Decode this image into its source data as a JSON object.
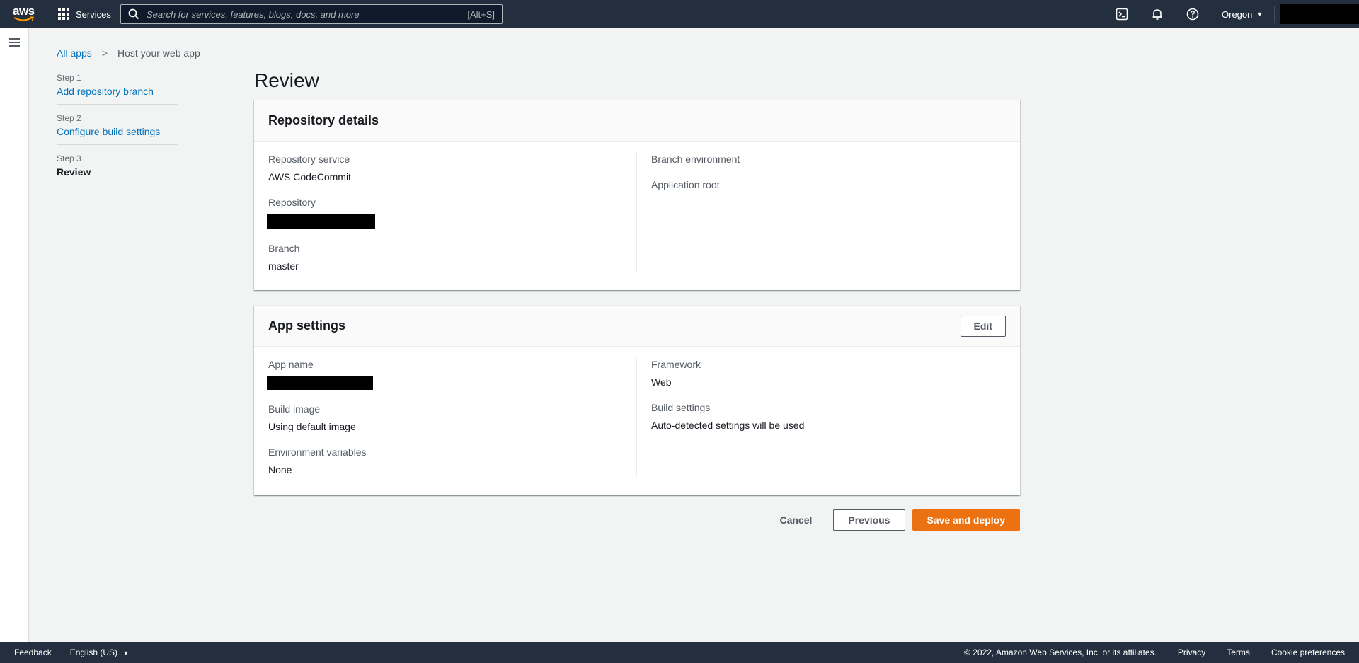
{
  "nav": {
    "logo_text": "aws",
    "services_label": "Services",
    "search_placeholder": "Search for services, features, blogs, docs, and more",
    "search_shortcut": "[Alt+S]",
    "region_label": "Oregon",
    "icons": [
      "cloudshell-icon",
      "bell-icon",
      "help-icon"
    ]
  },
  "breadcrumb": {
    "root": "All apps",
    "current": "Host your web app"
  },
  "steps": [
    {
      "num": "Step 1",
      "label": "Add repository branch",
      "state": "link"
    },
    {
      "num": "Step 2",
      "label": "Configure build settings",
      "state": "link"
    },
    {
      "num": "Step 3",
      "label": "Review",
      "state": "active"
    }
  ],
  "page_title": "Review",
  "repository_details": {
    "title": "Repository details",
    "service_label": "Repository service",
    "service_value": "AWS CodeCommit",
    "repository_label": "Repository",
    "branch_label": "Branch",
    "branch_value": "master",
    "branch_env_label": "Branch environment",
    "app_root_label": "Application root"
  },
  "app_settings": {
    "title": "App settings",
    "edit_label": "Edit",
    "app_name_label": "App name",
    "build_image_label": "Build image",
    "build_image_value": "Using default image",
    "env_vars_label": "Environment variables",
    "env_vars_value": "None",
    "framework_label": "Framework",
    "framework_value": "Web",
    "build_settings_label": "Build settings",
    "build_settings_value": "Auto-detected settings will be used"
  },
  "actions": {
    "cancel": "Cancel",
    "previous": "Previous",
    "save": "Save and deploy"
  },
  "footer": {
    "feedback": "Feedback",
    "language": "English (US)",
    "copyright": "© 2022, Amazon Web Services, Inc. or its affiliates.",
    "privacy": "Privacy",
    "terms": "Terms",
    "cookies": "Cookie preferences"
  },
  "colors": {
    "nav_bg": "#232f3e",
    "link": "#0073bb",
    "primary": "#ec7211"
  }
}
